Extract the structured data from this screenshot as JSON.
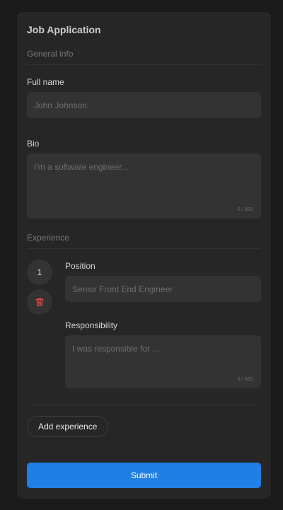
{
  "form": {
    "title": "Job Application",
    "submit_label": "Submit"
  },
  "general": {
    "section_label": "General info",
    "full_name_label": "Full name",
    "full_name_placeholder": "John Johnson",
    "full_name_value": "",
    "bio_label": "Bio",
    "bio_placeholder": "I'm a software engineer...",
    "bio_value": "",
    "bio_counter": "0 / 300"
  },
  "experience": {
    "section_label": "Experience",
    "entries": [
      {
        "number": "1",
        "position_label": "Position",
        "position_placeholder": "Senior Front End Engineer",
        "position_value": "",
        "responsibility_label": "Responsibility",
        "responsibility_placeholder": "I was responsible for ...",
        "responsibility_value": "",
        "responsibility_counter": "0 / 300"
      }
    ],
    "add_label": "Add experience"
  },
  "icons": {
    "delete": "trash-icon"
  },
  "colors": {
    "page_background": "#1a1a1a",
    "card_background": "#262626",
    "field_background": "#333333",
    "primary": "#1f7fe5",
    "danger": "#e5484d"
  }
}
